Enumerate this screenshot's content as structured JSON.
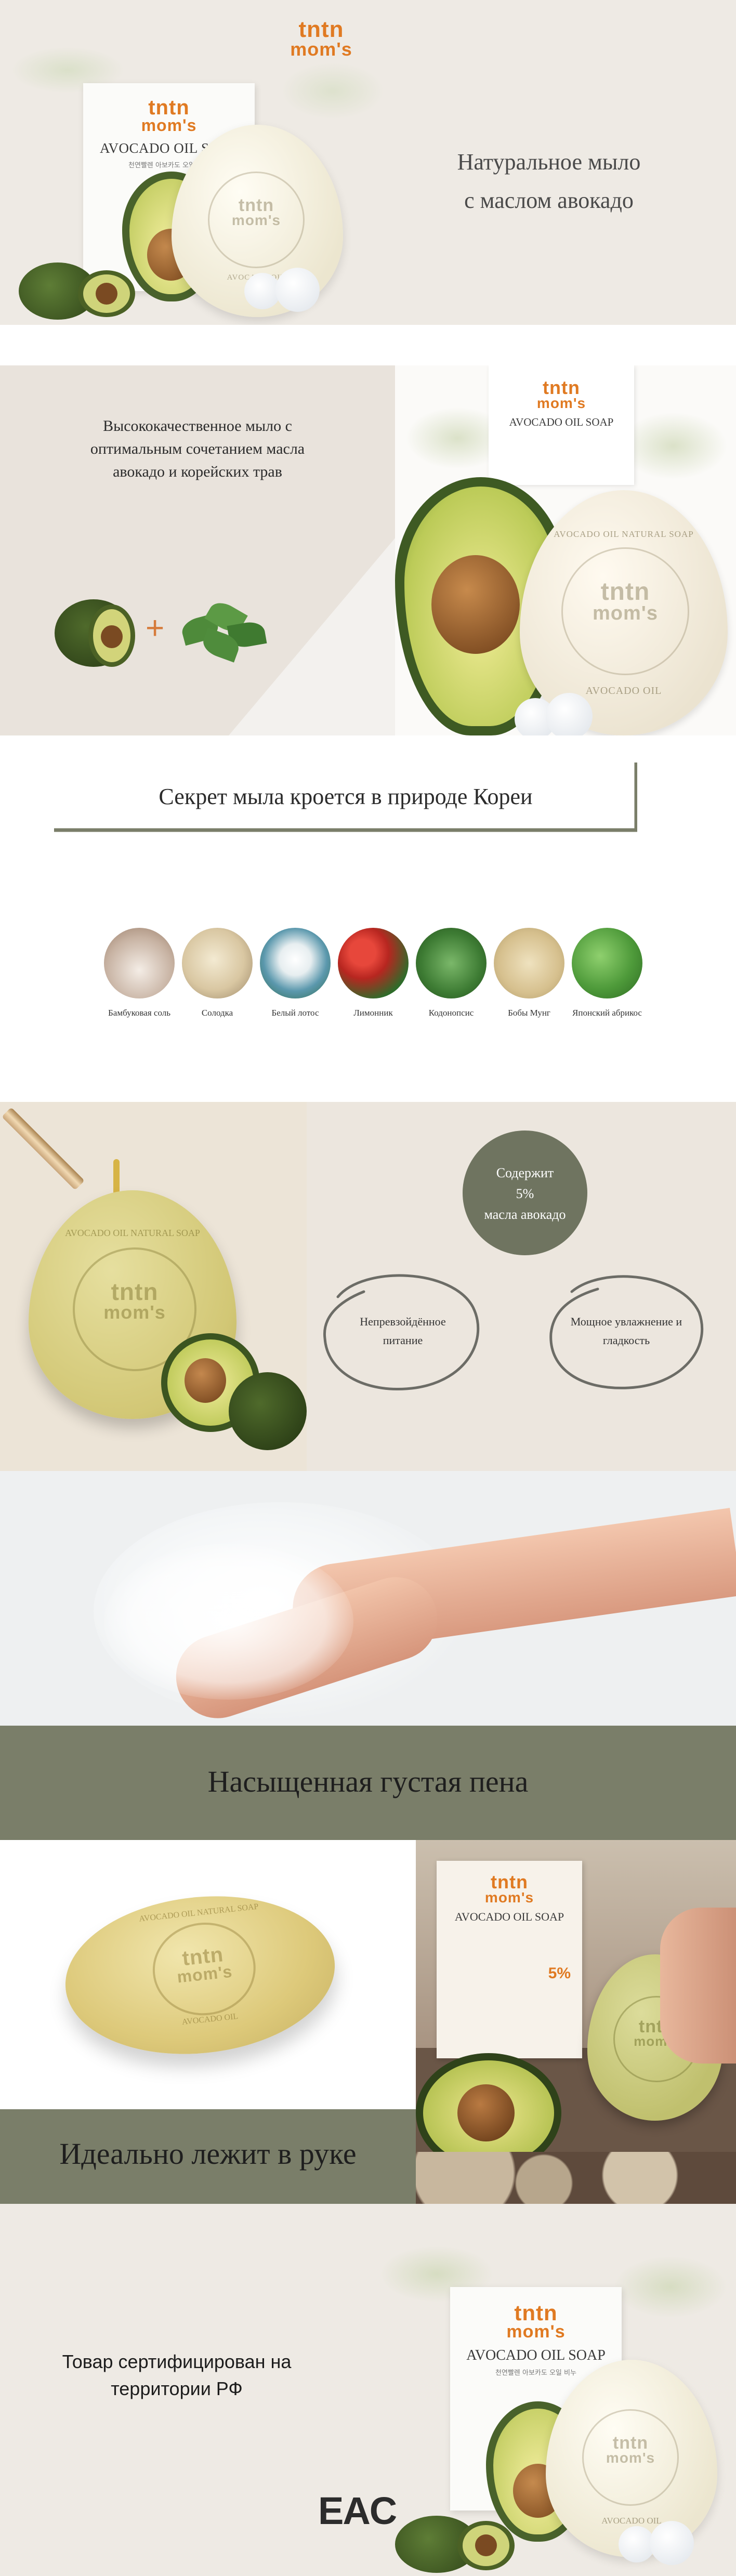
{
  "brand": {
    "line1": "tntn",
    "line2": "mom's"
  },
  "product": {
    "name": "AVOCADO OIL SOAP",
    "emboss_top": "AVOCADO OIL NATURAL SOAP",
    "emboss_bottom": "AVOCADO OIL",
    "box_subtitle": "천연빨렌 아보카도 오일 비누"
  },
  "hero": {
    "title_line1": "Натуральное мыло",
    "title_line2": "с маслом авокадо"
  },
  "intro": {
    "text_line1": "Высококачественное мыло с",
    "text_line2": "оптимальным сочетанием масла",
    "text_line3": "авокадо и корейских трав",
    "plus": "+"
  },
  "secret": {
    "title": "Секрет мыла кроется в природе Кореи",
    "ingredients": [
      {
        "label": "Бамбуковая соль",
        "color": "#d9c8bb"
      },
      {
        "label": "Солодка",
        "color": "#d9cba9"
      },
      {
        "label": "Белый лотос",
        "color": "#7cb0c7"
      },
      {
        "label": "Лимонник",
        "color": "#c5342d"
      },
      {
        "label": "Кодонопсис",
        "color": "#4b8a3f"
      },
      {
        "label": "Бобы Мунг",
        "color": "#d8c59a"
      },
      {
        "label": "Японский абрикос",
        "color": "#5aa246"
      }
    ]
  },
  "benefits": {
    "badge_line1": "Содержит",
    "badge_line2": "5%",
    "badge_line3": "масла авокадо",
    "item1_line1": "Непревзойдённое",
    "item1_line2": "питание",
    "item2_line1": "Мощное увлажнение и",
    "item2_line2": "гладкость"
  },
  "foam": {
    "title": "Насыщенная густая пена"
  },
  "hand": {
    "title": "Идеально лежит в руке",
    "box_percent": "5%"
  },
  "certification": {
    "line1": "Товар сертифицирован на",
    "line2": "территории РФ",
    "mark": "EAC"
  },
  "colors": {
    "accent_olive": "#7a7e69",
    "brand_orange": "#e07a22",
    "beige": "#eeeae4"
  }
}
